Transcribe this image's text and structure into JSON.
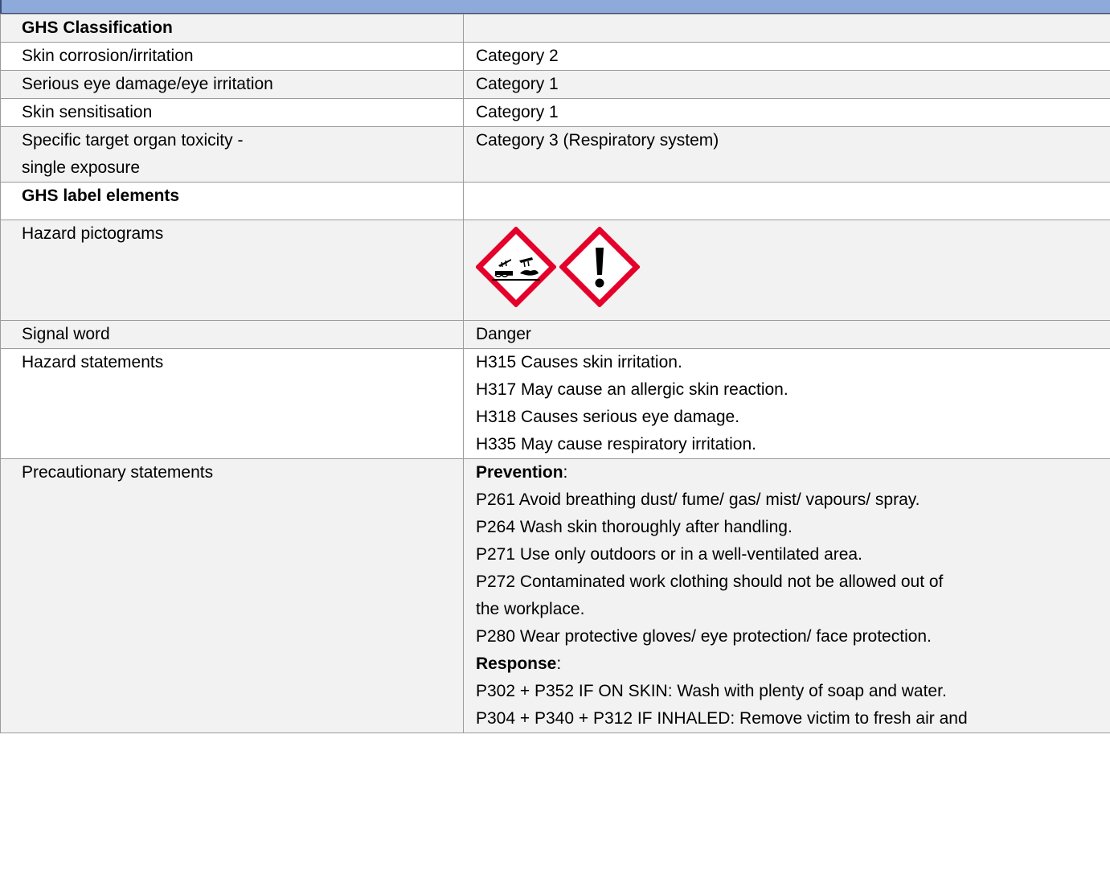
{
  "classification": {
    "header": "GHS Classification",
    "rows": [
      {
        "label": "Skin corrosion/irritation",
        "value": "Category 2"
      },
      {
        "label": "Serious eye damage/eye irritation",
        "value": "Category 1"
      },
      {
        "label": "Skin sensitisation",
        "value": "Category 1"
      },
      {
        "label_lines": [
          "Specific target organ toxicity -",
          "single exposure"
        ],
        "value": "Category 3 (Respiratory system)"
      }
    ]
  },
  "label_elements": {
    "header": "GHS label elements",
    "pictograms_label": "Hazard pictograms",
    "pictograms": [
      "corrosion-icon",
      "exclamation-mark-icon"
    ],
    "signal_word_label": "Signal word",
    "signal_word": "Danger",
    "hazard_statements_label": "Hazard statements",
    "hazard_statements": [
      "H315 Causes skin irritation.",
      "H317 May cause an allergic skin reaction.",
      "H318 Causes serious eye damage.",
      "H335 May cause respiratory irritation."
    ],
    "precautionary_label": "Precautionary statements",
    "prevention_heading": "Prevention",
    "prevention": [
      "P261 Avoid breathing dust/ fume/ gas/ mist/ vapours/ spray.",
      "P264 Wash skin thoroughly after handling.",
      "P271 Use only outdoors or in a well-ventilated area.",
      "P272 Contaminated work clothing should not be allowed out of",
      "the workplace.",
      "P280 Wear protective gloves/ eye protection/ face protection."
    ],
    "response_heading": "Response",
    "response": [
      "P302 + P352 IF ON SKIN: Wash with plenty of soap and water.",
      "P304 + P340 + P312 IF INHALED: Remove victim to fresh air and"
    ]
  },
  "colors": {
    "header_bar": "#8eaadb",
    "pictogram_border": "#e4002b",
    "shaded_row": "#f2f2f2"
  }
}
